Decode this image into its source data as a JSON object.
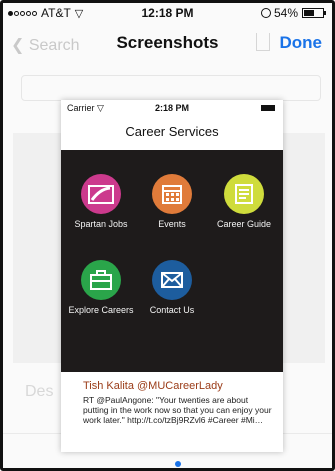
{
  "status": {
    "carrier": "AT&T",
    "time": "12:18 PM",
    "battery": "54%",
    "battery_fraction": 0.54
  },
  "nav": {
    "back": "Search",
    "title": "Screenshots",
    "done": "Done"
  },
  "background": {
    "label": "Des"
  },
  "screenshot": {
    "carrier": "Carrier",
    "time": "2:18 PM",
    "title": "Career Services",
    "apps": [
      {
        "label": "Spartan Jobs",
        "color": "#cc3a8d",
        "icon": "spartan-jobs-icon"
      },
      {
        "label": "Events",
        "color": "#e07b3a",
        "icon": "calendar-icon"
      },
      {
        "label": "Career Guide",
        "color": "#cfdc3c",
        "icon": "document-icon"
      },
      {
        "label": "Explore Careers",
        "color": "#2aa54a",
        "icon": "briefcase-icon"
      },
      {
        "label": "Contact Us",
        "color": "#1d5d9e",
        "icon": "envelope-icon"
      }
    ],
    "tweet": {
      "author": "Tish Kalita @MUCareerLady",
      "text": "RT @PaulAngone: \"Your twenties are about putting in the work now so that you can enjoy your work later.\" http://t.co/tzBj9RZvl6 #Career #Mi…"
    }
  }
}
